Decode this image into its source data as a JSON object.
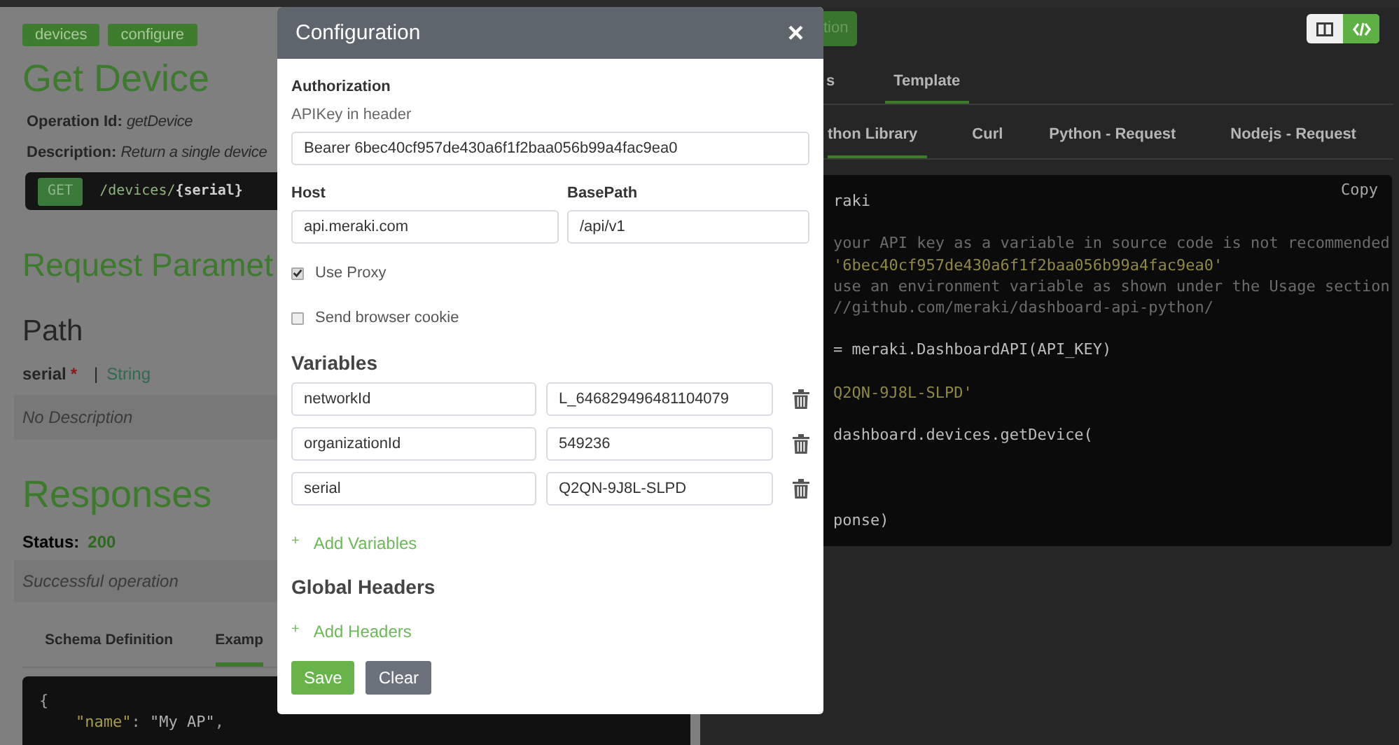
{
  "left_panel": {
    "tags": [
      "devices",
      "configure"
    ],
    "title": "Get Device",
    "operation_id": {
      "label": "Operation Id:",
      "value": "getDevice"
    },
    "description": {
      "label": "Description:",
      "value": "Return a single device"
    },
    "endpoint": {
      "method": "GET",
      "path": "/devices/",
      "param": "{serial}"
    },
    "request_heading": "Request Paramet",
    "path_heading": "Path",
    "parameter": {
      "name": "serial",
      "required_mark": "*",
      "separator": "|",
      "type": "String",
      "description": "No Description"
    },
    "responses_heading": "Responses",
    "status": {
      "label": "Status:",
      "code": "200",
      "description": "Successful operation"
    },
    "tabs": [
      {
        "label": "Schema Definition",
        "selected": false
      },
      {
        "label": "Examp",
        "selected": true
      }
    ],
    "example_lines": [
      [
        {
          "kind": "punct",
          "text": "{"
        }
      ],
      [
        {
          "kind": "key",
          "text": "\"name\""
        },
        {
          "kind": "punct",
          "text": ": "
        },
        {
          "kind": "string",
          "text": "\"My AP\""
        },
        {
          "kind": "punct",
          "text": ","
        }
      ]
    ]
  },
  "right_panel": {
    "run_button": "tion",
    "view_toggle": [
      {
        "kind": "columns",
        "selected": false
      },
      {
        "kind": "code",
        "selected": true
      }
    ],
    "tabs": [
      {
        "label": "s",
        "selected": false
      },
      {
        "label": "Template",
        "selected": true
      }
    ],
    "subtabs": [
      {
        "label": "thon Library",
        "selected": true
      },
      {
        "label": "Curl",
        "selected": false
      },
      {
        "label": "Python - Request",
        "selected": false
      },
      {
        "label": "Nodejs - Request",
        "selected": false
      }
    ],
    "copy": "Copy",
    "code_lines": [
      {
        "kind": "code",
        "text": "raki"
      },
      {
        "kind": "blank"
      },
      {
        "kind": "comment",
        "text": "your API key as a variable in source code is not recommended"
      },
      {
        "kind": "string",
        "text": "'6bec40cf957de430a6f1f2baa056b99a4fac9ea0'"
      },
      {
        "kind": "comment",
        "text": "use an environment variable as shown under the Usage section"
      },
      {
        "kind": "comment",
        "text": "//github.com/meraki/dashboard-api-python/"
      },
      {
        "kind": "blank"
      },
      {
        "kind": "code",
        "text": "= meraki.DashboardAPI(API_KEY)"
      },
      {
        "kind": "blank"
      },
      {
        "kind": "string",
        "text": "Q2QN-9J8L-SLPD'"
      },
      {
        "kind": "blank"
      },
      {
        "kind": "code",
        "text": "dashboard.devices.getDevice("
      },
      {
        "kind": "blank"
      },
      {
        "kind": "blank"
      },
      {
        "kind": "blank"
      },
      {
        "kind": "code",
        "text": "ponse)"
      }
    ]
  },
  "modal": {
    "title": "Configuration",
    "close": "×",
    "authorization": {
      "heading": "Authorization",
      "label": "APIKey in header",
      "value": "Bearer 6bec40cf957de430a6f1f2baa056b99a4fac9ea0"
    },
    "host": {
      "label": "Host",
      "value": "api.meraki.com"
    },
    "base_path": {
      "label": "BasePath",
      "value": "/api/v1"
    },
    "options": [
      {
        "label": "Use Proxy",
        "checked": true
      },
      {
        "label": "Send browser cookie",
        "checked": false
      }
    ],
    "variables_heading": "Variables",
    "variables": [
      {
        "name": "networkId",
        "value": "L_646829496481104079"
      },
      {
        "name": "organizationId",
        "value": "549236"
      },
      {
        "name": "serial",
        "value": "Q2QN-9J8L-SLPD"
      }
    ],
    "add_variables": {
      "icon": "+",
      "label": "Add Variables"
    },
    "global_headers_heading": "Global Headers",
    "add_headers": {
      "icon": "+",
      "label": "Add Headers"
    },
    "buttons": [
      {
        "kind": "primary",
        "label": "Save"
      },
      {
        "kind": "secondary",
        "label": "Clear"
      }
    ]
  }
}
